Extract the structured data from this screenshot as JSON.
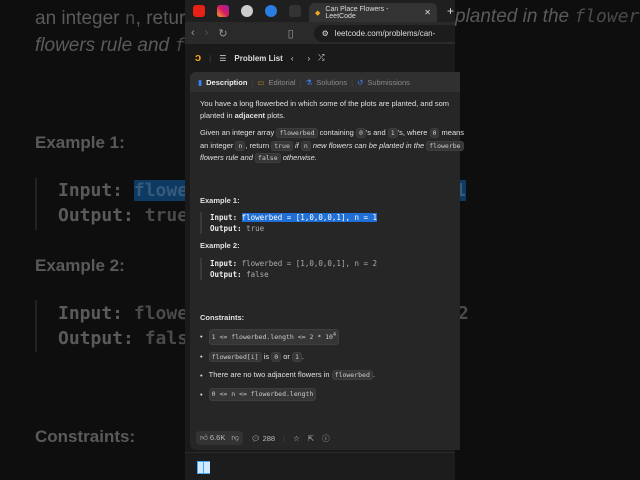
{
  "background": {
    "line1_prefix": "an integer",
    "line1_code": "n",
    "line1_suffix": ", retur",
    "line2": "flowers rule and",
    "line2_code": "fa",
    "right_line": "planted in the",
    "right_code": "flowerbe",
    "ex1": "Example 1:",
    "input": "Input:",
    "input1": "flowe",
    "output": "Output:",
    "output1": "true",
    "trail1": "1",
    "ex2": "Example 2:",
    "input2": "flowe",
    "output2": "fals",
    "trail2": "2",
    "constraints": "Constraints:"
  },
  "browser": {
    "tab_title": "Can Place Flowers - LeetCode",
    "url": "leetcode.com/problems/can-"
  },
  "nav": {
    "problem_list": "Problem List"
  },
  "panel_tabs": [
    "Description",
    "Editorial",
    "Solutions",
    "Submissions"
  ],
  "description": {
    "p1a": "You have a long flowerbed in which some of the plots are planted, and som",
    "p1b": "planted in",
    "p1_bold": "adjacent",
    "p1c": "plots.",
    "p2a": "Given an integer array",
    "c_flowerbed": "flowerbed",
    "p2b": "containing",
    "c0": "0",
    "p2c": "'s and",
    "c1": "1",
    "p2d": "'s, where",
    "p2e": "means",
    "p3a": "an integer",
    "c_n": "n",
    "p3b": ", return",
    "c_true": "true",
    "p3c": "if",
    "p3d": "new flowers can be planted in the",
    "c_flowerbe": "flowerbe",
    "p4a": "flowers rule and",
    "c_false": "false",
    "p4b": "otherwise."
  },
  "examples": [
    {
      "title": "Example 1:",
      "input_label": "Input:",
      "input": "flowerbed = [1,0,0,0,1], n = 1",
      "output_label": "Output:",
      "output": "true"
    },
    {
      "title": "Example 2:",
      "input_label": "Input:",
      "input": "flowerbed = [1,0,0,0,1], n = 2",
      "output_label": "Output:",
      "output": "false"
    }
  ],
  "constraints": {
    "title": "Constraints:",
    "c1": "1 <= flowerbed.length <= 2 * 10",
    "c1_exp": "4",
    "c2_code": "flowerbed[i]",
    "c2_is": "is",
    "c2_0": "0",
    "c2_or": "or",
    "c2_1": "1",
    "c2_end": ".",
    "c3": "There are no two adjacent flowers in",
    "c3_code": "flowerbed",
    "c3_end": ".",
    "c4": "0 <= n <= flowerbed.length"
  },
  "footer": {
    "likes": "6.6K",
    "comments": "288"
  }
}
